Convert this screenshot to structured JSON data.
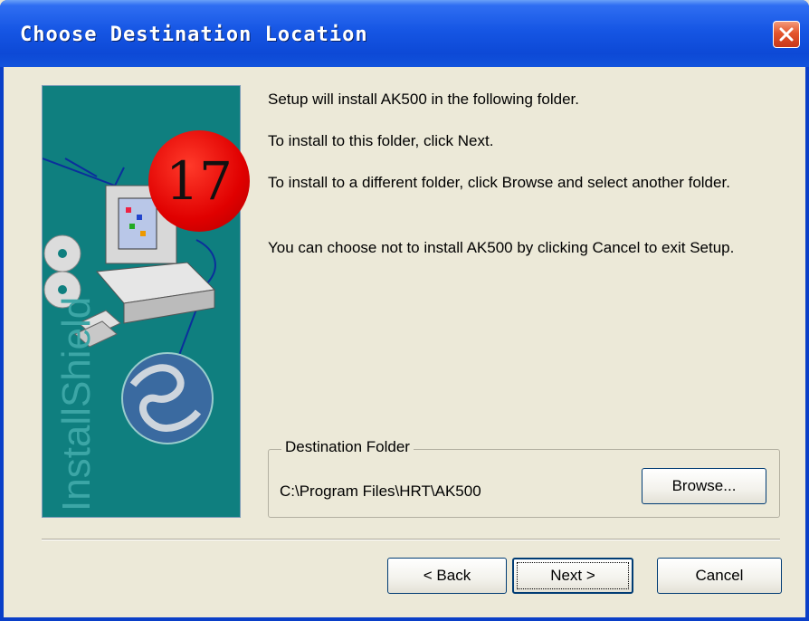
{
  "window": {
    "title": "Choose Destination Location"
  },
  "badge": "17",
  "messages": {
    "line1": "Setup will install AK500 in the following folder.",
    "line2": "To install to this folder, click Next.",
    "line3": "To install to a different folder, click Browse and select another folder.",
    "line4": "You can choose not to install AK500 by clicking Cancel to exit Setup."
  },
  "destination": {
    "group_label": "Destination Folder",
    "path": "C:\\Program Files\\HRT\\AK500",
    "browse_label": "Browse..."
  },
  "buttons": {
    "back_label": "< Back",
    "next_label": "Next >",
    "cancel_label": "Cancel"
  },
  "banner": {
    "brand": "InstallShield"
  },
  "colors": {
    "titlebar": "#0d49d6",
    "banner": "#0f7f7f",
    "badge": "#e00000"
  },
  "icons": [
    "close-icon",
    "computer-icon",
    "cd-icon",
    "floppy-icon",
    "globe-icon"
  ]
}
